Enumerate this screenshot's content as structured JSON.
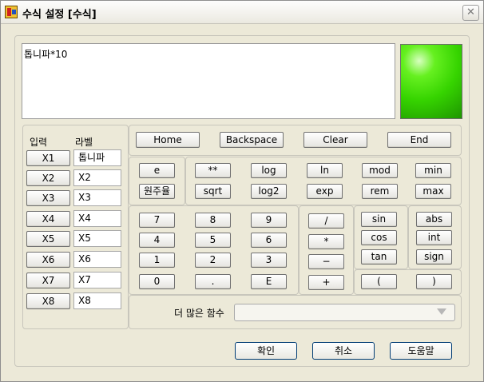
{
  "window": {
    "title": "수식 설정 [수식]",
    "close_glyph": "✕"
  },
  "formula": {
    "value": "톱니파*10"
  },
  "indicator": {
    "color": "#3ed800"
  },
  "inputs": {
    "header_input": "입력",
    "header_label": "라벨",
    "rows": [
      {
        "button": "X1",
        "label": "톱니파"
      },
      {
        "button": "X2",
        "label": "X2"
      },
      {
        "button": "X3",
        "label": "X3"
      },
      {
        "button": "X4",
        "label": "X4"
      },
      {
        "button": "X5",
        "label": "X5"
      },
      {
        "button": "X6",
        "label": "X6"
      },
      {
        "button": "X7",
        "label": "X7"
      },
      {
        "button": "X8",
        "label": "X8"
      }
    ]
  },
  "edit_buttons": {
    "home": "Home",
    "backspace": "Backspace",
    "clear": "Clear",
    "end": "End"
  },
  "constants": {
    "e": "e",
    "pi": "원주율"
  },
  "functions": {
    "power": "**",
    "log": "log",
    "ln": "ln",
    "mod": "mod",
    "min": "min",
    "sqrt": "sqrt",
    "log2": "log2",
    "exp": "exp",
    "rem": "rem",
    "max": "max"
  },
  "keypad": {
    "d7": "7",
    "d8": "8",
    "d9": "9",
    "d4": "4",
    "d5": "5",
    "d6": "6",
    "d1": "1",
    "d2": "2",
    "d3": "3",
    "d0": "0",
    "dot": ".",
    "exp_e": "E"
  },
  "operators": {
    "div": "/",
    "mul": "*",
    "sub": "−",
    "add": "+"
  },
  "trig": {
    "sin": "sin",
    "cos": "cos",
    "tan": "tan"
  },
  "misc": {
    "abs": "abs",
    "int": "int",
    "sign": "sign"
  },
  "parens": {
    "open": "(",
    "close": ")"
  },
  "more_functions": {
    "label": "더 많은 함수",
    "selected": ""
  },
  "dialog": {
    "ok": "확인",
    "cancel": "취소",
    "help": "도움말"
  }
}
